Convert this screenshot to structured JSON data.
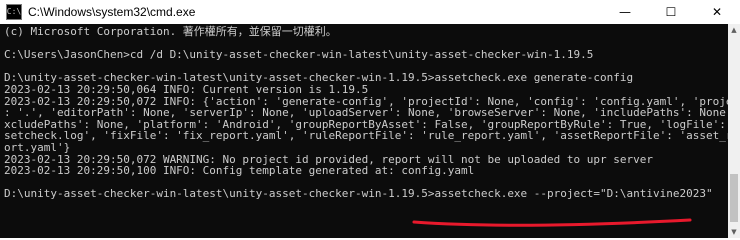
{
  "window": {
    "title": "C:\\Windows\\system32\\cmd.exe",
    "minimize_glyph": "—",
    "maximize_glyph": "☐",
    "close_glyph": "✕",
    "icon": "cmd-icon",
    "icon_text": "C:\\"
  },
  "console": {
    "lines": [
      "(c) Microsoft Corporation. 著作權所有，並保留一切權利。",
      "",
      "C:\\Users\\JasonChen>cd /d D:\\unity-asset-checker-win-latest\\unity-asset-checker-win-1.19.5",
      "",
      "D:\\unity-asset-checker-win-latest\\unity-asset-checker-win-1.19.5>assetcheck.exe generate-config",
      "2023-02-13 20:29:50,064 INFO: Current version is 1.19.5",
      "2023-02-13 20:29:50,072 INFO: {'action': 'generate-config', 'projectId': None, 'config': 'config.yaml', 'project'",
      ": '.', 'editorPath': None, 'serverIp': None, 'uploadServer': None, 'browseServer': None, 'includePaths': None, 'e",
      "xcludePaths': None, 'platform': 'Android', 'groupReportByAsset': False, 'groupReportByRule': True, 'logFile': 'as",
      "setcheck.log', 'fixFile': 'fix_report.yaml', 'ruleReportFile': 'rule_report.yaml', 'assetReportFile': 'asset_rep",
      "ort.yaml'}",
      "2023-02-13 20:29:50,072 WARNING: No project id provided, report will not be uploaded to upr server",
      "2023-02-13 20:29:50,100 INFO: Config template generated at: config.yaml",
      "",
      "D:\\unity-asset-checker-win-latest\\unity-asset-checker-win-1.19.5>assetcheck.exe --project=\"D:\\antivine2023\""
    ]
  },
  "annotation": {
    "underline_color": "#e8192c"
  },
  "scrollbar": {
    "up_glyph": "▲",
    "down_glyph": "▼"
  }
}
